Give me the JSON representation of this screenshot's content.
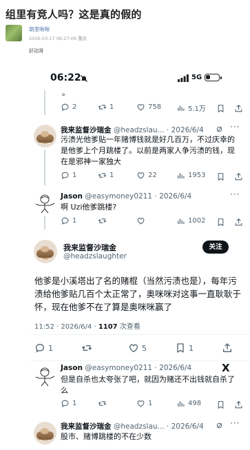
{
  "post": {
    "title": "组里有竞人吗？这是真的假的",
    "username": "朝里啾啾",
    "meta": "2026-03-17 06:27:09 重庆",
    "body": "好动滑"
  },
  "status_bar": {
    "time": "06:22",
    "network": "5G"
  },
  "tweets": [
    {
      "text_fragment": "。",
      "actions": {
        "reply": "2",
        "retweet": "1",
        "like": "758",
        "views": "5.1万"
      }
    },
    {
      "name": "我来监督沙瑞金",
      "handle": "@headzslau...",
      "date": "· 2026/6/4",
      "text": "污渍光他爹贴一年赌博钱就是好几百万，不过庆幸的是他爹上个月跳楼了。以前是两家人争污渍的钱，现在是邪神一家独大",
      "actions": {
        "reply": "1",
        "retweet": "1",
        "like": "22",
        "views": "1953"
      }
    },
    {
      "name": "Jason",
      "handle": "@easymoney0211",
      "date": "· 2026/6/4",
      "text": "啊 Uzi他爹跳楼?",
      "actions": {
        "reply": "1",
        "retweet": "",
        "like": "",
        "views": "1002"
      }
    }
  ],
  "main_tweet": {
    "name": "我来监督沙瑞金",
    "handle": "@headzslaughter",
    "follow_label": "关注",
    "text": "他爹是小溪塔出了名的赌棍（当然污渍也是），每年污渍给他爹贴几百个太正常了，奥咪咪对这事一直耿耿于怀，现在他爹不在了算是奥咪咪赢了",
    "time": "11:52 · 2026/6/4 · ",
    "views_count": "1107",
    "views_label": " 次查看",
    "actions": {
      "reply": "1",
      "retweet": "",
      "like": "5",
      "bookmark": "1"
    }
  },
  "replies": [
    {
      "name": "Jason",
      "handle": "@easymoney0211",
      "date": "· 2026/6/4",
      "text": "但是自杀也太夸张了吧，就因为赌还不出钱就自杀了么",
      "actions": {
        "reply": "1",
        "retweet": "",
        "like": "1",
        "views": "498"
      }
    },
    {
      "name": "我来监督沙瑞金",
      "handle": "@headzslau...",
      "date": "· 2026/6/4",
      "text": "股市、赌博跳楼的不在少数"
    }
  ],
  "icons": {
    "reply": "reply-icon",
    "retweet": "retweet-icon",
    "like": "like-icon",
    "views": "views-icon",
    "bookmark": "bookmark-icon",
    "share": "share-icon",
    "grok": "grok-icon",
    "more": "more-icon",
    "x_logo": "x-logo-icon"
  }
}
